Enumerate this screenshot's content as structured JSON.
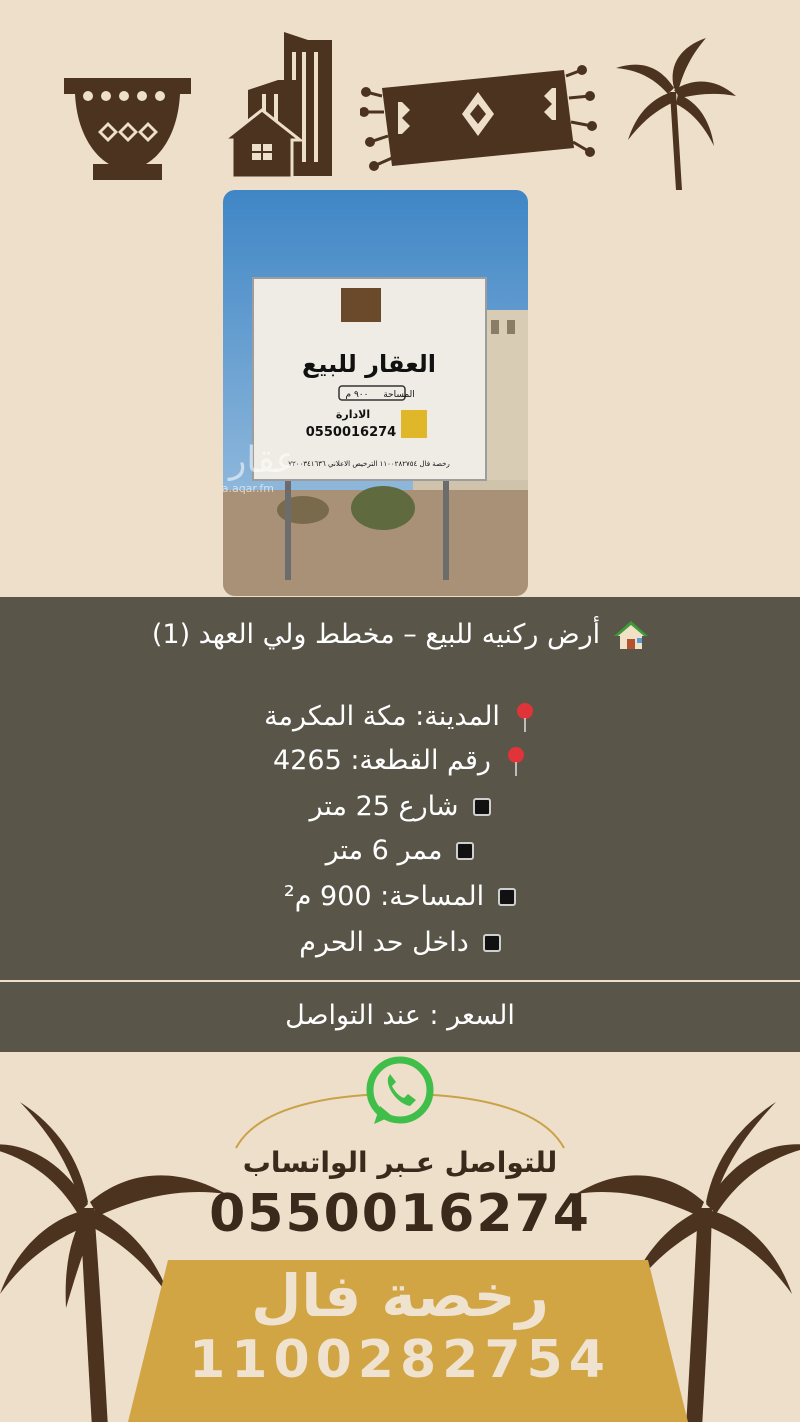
{
  "photo": {
    "sign_title": "العقار للبيع",
    "sign_area_label": "المساحة",
    "sign_area_value": "٩٠٠ م",
    "sign_admin_label": "الادارة",
    "sign_phone": "0550016274",
    "sign_footer": "رخصة فال ١١٠٠٢٨٢٧٥٤   الترخيص الاعلاني ٧٢٠٠٣٤١٦٣٦",
    "watermark": "عقار",
    "watermark_site": "sa.aqar.fm"
  },
  "listing": {
    "title": "أرض ركنيه للبيع – مخطط ولي العهد (1)",
    "city": "المدينة: مكة المكرمة",
    "plot": "رقم القطعة: 4265",
    "street": "شارع 25 متر",
    "passage": "ممر 6 متر",
    "area": "المساحة: 900 م²",
    "haram": "داخل حد الحرم"
  },
  "price": {
    "text": "السعر : عند التواصل"
  },
  "contact": {
    "label": "للتواصل عـبر الواتساب",
    "phone": "0550016274"
  },
  "license": {
    "label": "رخصة فال",
    "number": "1100282754"
  },
  "colors": {
    "background": "#eedfca",
    "band": "#595649",
    "brown": "#4b3320",
    "gold": "#d1a544"
  },
  "icons": [
    "pot-icon",
    "buildings-icon",
    "rug-icon",
    "palm-tree-icon",
    "pin-icon",
    "house-icon",
    "whatsapp-icon"
  ]
}
